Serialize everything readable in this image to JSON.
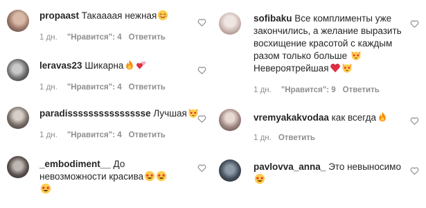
{
  "comments": [
    {
      "username": "propaast",
      "text": "Такаааая нежная",
      "emoji": [
        "blush"
      ],
      "time": "1 дн.",
      "likes": "\"Нравится\": 4",
      "reply": "Ответить"
    },
    {
      "username": "leravas23",
      "text": "Шикарна",
      "emoji": [
        "fire",
        "two-hearts"
      ],
      "time": "1 дн.",
      "likes": "\"Нравится\": 4",
      "reply": "Ответить"
    },
    {
      "username": "paradissssssssssssssse",
      "text": "Лучшая",
      "emoji": [
        "heart-eyes-cat"
      ],
      "time": "1 дн.",
      "likes": "\"Нравится\": 4",
      "reply": "Ответить"
    },
    {
      "username": "_embodiment__",
      "text": "До невозможности красива",
      "emoji": [
        "star-struck",
        "star-struck",
        "star-struck"
      ],
      "time": "",
      "likes": "",
      "reply": ""
    },
    {
      "username": "sofibaku",
      "text": "Все комплименты уже закончились, а желание выразить восхищение красотой с каждым разом только больше",
      "text2": "Невероятрейшая",
      "emoji": [
        "heart-eyes-cat",
        "red-heart",
        "heart-eyes-cat"
      ],
      "time": "1 дн.",
      "likes": "\"Нравится\": 9",
      "reply": "Ответить"
    },
    {
      "username": "vremyakakvodaa",
      "text": "как всегда",
      "emoji": [
        "fire"
      ],
      "time": "1 дн.",
      "likes": "",
      "reply": "Ответить"
    },
    {
      "username": "pavlovva_anna_",
      "text": "Это невыносимо",
      "emoji": [
        "star-struck"
      ],
      "time": "",
      "likes": "",
      "reply": ""
    }
  ],
  "colors": {
    "text": "#262626",
    "meta": "#8e8e8e",
    "heart_outline": "#8e8e8e"
  },
  "icons": {
    "like": "heart-outline-icon"
  }
}
